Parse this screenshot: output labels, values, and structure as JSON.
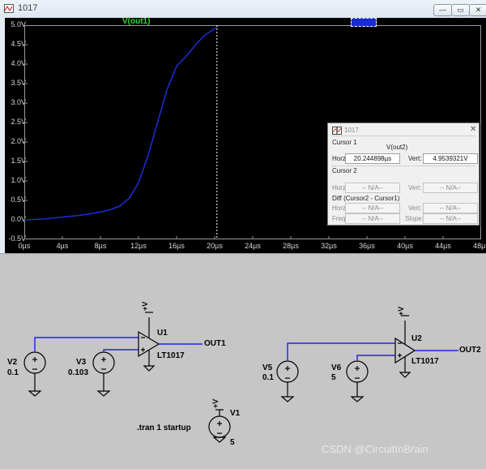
{
  "window": {
    "title": "1017",
    "buttons": {
      "minimize": "—",
      "restore": "▭",
      "close": "✕"
    }
  },
  "plot": {
    "trace_label": "V(out1)",
    "y_ticks": [
      "5.0V",
      "4.5V",
      "4.0V",
      "3.5V",
      "3.0V",
      "2.5V",
      "2.0V",
      "1.5V",
      "1.0V",
      "0.5V",
      "0.0V",
      "-0.5V"
    ],
    "x_ticks": [
      "0µs",
      "4µs",
      "8µs",
      "12µs",
      "16µs",
      "20µs",
      "24µs",
      "28µs",
      "32µs",
      "36µs",
      "40µs",
      "44µs",
      "48µs"
    ],
    "trace_color": "#1b2bd0",
    "cursor_color": "#ffffff",
    "background": "#000000"
  },
  "chart_data": {
    "type": "line",
    "xlabel": "",
    "ylabel": "",
    "xlim": [
      0,
      48
    ],
    "ylim": [
      -0.5,
      5.0
    ],
    "x_unit": "µs",
    "y_unit": "V",
    "grid": false,
    "series": [
      {
        "name": "V(out1)",
        "x": [
          0,
          2,
          4,
          6,
          8,
          9,
          10,
          11,
          12,
          13,
          14,
          15,
          16,
          17,
          18,
          19,
          20.24
        ],
        "y": [
          0.0,
          0.02,
          0.07,
          0.12,
          0.2,
          0.26,
          0.35,
          0.55,
          0.95,
          1.65,
          2.5,
          3.35,
          3.95,
          4.2,
          4.5,
          4.75,
          4.95
        ]
      }
    ],
    "cursor_x": 20.24
  },
  "cursor_dialog": {
    "title": "1017",
    "cursor1": "Cursor 1",
    "trace": "V(out2)",
    "horz_label": "Horz:",
    "vert_label": "Vert:",
    "horz_value": "20.244898µs",
    "vert_value": "4.9539321V",
    "cursor2": "Cursor 2",
    "na": "-- N/A--",
    "diff": "Diff (Cursor2 - Cursor1)",
    "freq_label": "Freq:",
    "slope_label": "Slope:"
  },
  "schematic": {
    "u1": "U1",
    "u1_part": "LT1017",
    "out1": "OUT1",
    "v2": "V2",
    "v2_val": "0.1",
    "v3": "V3",
    "v3_val": "0.103",
    "u2": "U2",
    "u2_part": "LT1017",
    "out2": "OUT2",
    "v5": "V5",
    "v5_val": "0.1",
    "v6": "V6",
    "v6_val": "5",
    "v1": "V1",
    "v1_val": "5",
    "directive": ".tran 1 startup",
    "supply": "+V",
    "wire_color": "#0000ff",
    "comp_color": "#000000"
  },
  "watermark": "CSDN @CircuitInBrain"
}
